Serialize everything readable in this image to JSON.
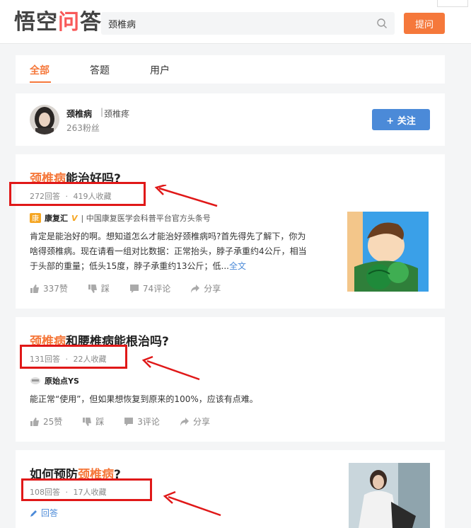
{
  "header": {
    "logo_part1": "悟空",
    "logo_accent": "问",
    "logo_part2": "答",
    "search_value": "颈椎病",
    "ask_button": "提问",
    "search_icon": "search-icon"
  },
  "tabs": [
    {
      "label": "全部",
      "active": true
    },
    {
      "label": "答题",
      "active": false
    },
    {
      "label": "用户",
      "active": false
    }
  ],
  "topic": {
    "name": "颈椎病",
    "separator": "|",
    "alias": "颈椎疼",
    "fans": "263粉丝",
    "follow_label": "+ 关注"
  },
  "questions": [
    {
      "title_hl": "颈椎病",
      "title_rest": "能治好吗?",
      "answers": "272回答",
      "dot": "·",
      "favorites": "419人收藏",
      "author": "康复汇",
      "author_badge": "V",
      "author_desc": "| 中国康复医学会科普平台官方头条号",
      "text_line1": "肯定是能治好的啊。想知道怎么才能治好颈椎病吗?首先得先了解下，你为",
      "text_line2": "啥得颈椎病。现在请看一组对比数据：正常抬头，脖子承重约4公斤，相当",
      "text_line3": "于头部的重量；低头15度，脖子承重约13公斤；低...",
      "more": "全文",
      "likes": "337赞",
      "dislike": "踩",
      "comments": "74评论",
      "share": "分享"
    },
    {
      "title_hl": "颈椎病",
      "title_rest": "和腰椎病能根治吗?",
      "answers": "131回答",
      "dot": "·",
      "favorites": "22人收藏",
      "author": "原始点YS",
      "text_line1": "能正常“使用”，但如果想恢复到原来的100%，应该有点难。",
      "likes": "25赞",
      "dislike": "踩",
      "comments": "3评论",
      "share": "分享"
    },
    {
      "title_pre": "如何预防",
      "title_hl": "颈椎病",
      "title_post": "?",
      "answers": "108回答",
      "dot": "·",
      "favorites": "17人收藏",
      "answer_btn": "回答"
    }
  ],
  "colors": {
    "accent": "#f5783b",
    "brand_red": "#f85959",
    "follow_blue": "#4b8ad8",
    "annotation_red": "#e01818"
  }
}
